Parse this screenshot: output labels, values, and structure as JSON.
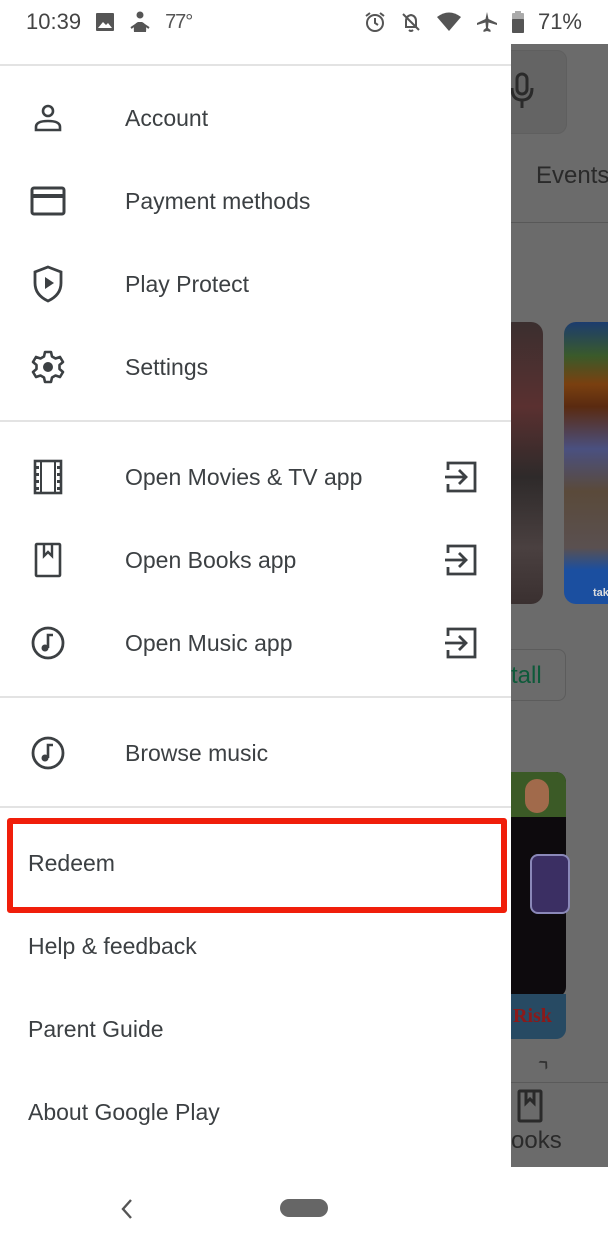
{
  "status_bar": {
    "time": "10:39",
    "temperature": "77°",
    "battery": "71%",
    "icons": [
      "image-icon",
      "weather-icon",
      "alarm-icon",
      "notifications-off-icon",
      "wifi-icon",
      "airplane-icon",
      "battery-icon"
    ]
  },
  "background_app": {
    "tab_label": "Events",
    "install_label": "tall",
    "card_label": "tak",
    "app_label": "Risk",
    "bottom_nav_label": "ooks"
  },
  "drawer": {
    "sections": [
      {
        "items": [
          {
            "label": "Account",
            "icon": "account-icon"
          },
          {
            "label": "Payment methods",
            "icon": "credit-card-icon"
          },
          {
            "label": "Play Protect",
            "icon": "play-protect-shield-icon"
          },
          {
            "label": "Settings",
            "icon": "settings-gear-icon"
          }
        ]
      },
      {
        "items": [
          {
            "label": "Open Movies & TV app",
            "icon": "film-icon",
            "trailing_icon": "open-app-icon"
          },
          {
            "label": "Open Books app",
            "icon": "book-icon",
            "trailing_icon": "open-app-icon"
          },
          {
            "label": "Open Music app",
            "icon": "music-note-icon",
            "trailing_icon": "open-app-icon"
          }
        ]
      },
      {
        "items": [
          {
            "label": "Browse music",
            "icon": "music-note-icon"
          }
        ]
      },
      {
        "items": [
          {
            "label": "Redeem",
            "highlighted": true
          },
          {
            "label": "Help & feedback"
          },
          {
            "label": "Parent Guide"
          },
          {
            "label": "About Google Play"
          }
        ]
      }
    ],
    "highlight_color": "#f01e0a"
  },
  "nav_bar": {
    "back_icon": "‹"
  }
}
